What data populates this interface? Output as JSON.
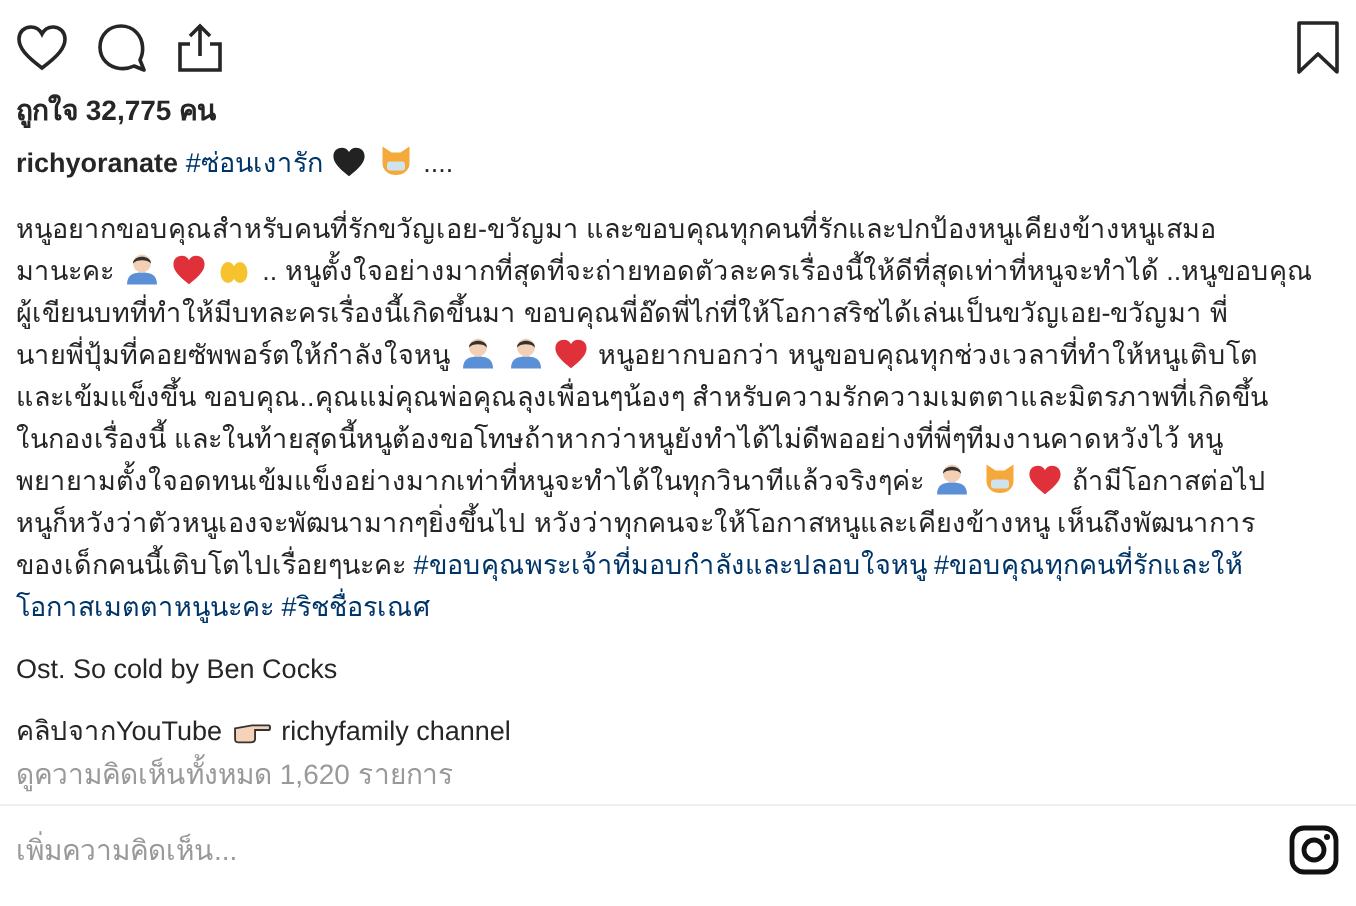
{
  "likes": "ถูกใจ 32,775 คน",
  "caption": {
    "username": "richyoranate",
    "heading": [
      {
        "kind": "tag",
        "text": "#ซ่อนเงารัก"
      },
      {
        "kind": "heart",
        "color": "#222222"
      },
      {
        "kind": "cat"
      },
      {
        "kind": "text",
        "text": "...."
      }
    ],
    "body_lines": [
      [
        {
          "kind": "text",
          "text": "หนูอยากขอบคุณสำหรับคนที่รักขวัญเอย-ขวัญมา และขอบคุณทุกคนที่รักและปกป้องหนูเคียงข้างหนูเสมอ"
        }
      ],
      [
        {
          "kind": "text",
          "text": "มานะคะ"
        },
        {
          "kind": "person"
        },
        {
          "kind": "heart",
          "color": "#e0303a"
        },
        {
          "kind": "hands"
        },
        {
          "kind": "text",
          "text": ".. หนูตั้งใจอย่างมากที่สุดที่จะถ่ายทอดตัวละครเรื่องนี้ให้ดีที่สุดเท่าที่หนูจะทำได้ ..หนูขอบคุณ"
        }
      ],
      [
        {
          "kind": "text",
          "text": "ผู้เขียนบทที่ทำให้มีบทละครเรื่องนี้เกิดขึ้นมา ขอบคุณพี่อ๊ดพี่ไก่ที่ให้โอกาสริชได้เล่นเป็นขวัญเอย-ขวัญมา พี่"
        }
      ],
      [
        {
          "kind": "text",
          "text": "นายพี่ปุ้มที่คอยซัพพอร์ตให้กำลังใจหนู"
        },
        {
          "kind": "person"
        },
        {
          "kind": "person"
        },
        {
          "kind": "heart",
          "color": "#e0303a"
        },
        {
          "kind": "text",
          "text": "หนูอยากบอกว่า หนูขอบคุณทุกช่วงเวลาที่ทำให้หนูเติบโต"
        }
      ],
      [
        {
          "kind": "text",
          "text": "และเข้มแข็งขึ้น ขอบคุณ..คุณแม่คุณพ่อคุณลุงเพื่อนๆน้องๆ สำหรับความรักความเมตตาและมิตรภาพที่เกิดขึ้น"
        }
      ],
      [
        {
          "kind": "text",
          "text": "ในกองเรื่องนี้ และในท้ายสุดนี้หนูต้องขอโทษถ้าหากว่าหนูยังทำได้ไม่ดีพออย่างที่พี่ๆทีมงานคาดหวังไว้ หนู"
        }
      ],
      [
        {
          "kind": "text",
          "text": "พยายามตั้งใจอดทนเข้มแข็งอย่างมากเท่าที่หนูจะทำได้ในทุกวินาทีแล้วจริงๆค่ะ"
        },
        {
          "kind": "person"
        },
        {
          "kind": "cat"
        },
        {
          "kind": "heart",
          "color": "#e0303a"
        },
        {
          "kind": "text",
          "text": "ถ้ามีโอกาสต่อไป"
        }
      ],
      [
        {
          "kind": "text",
          "text": "หนูก็หวังว่าตัวหนูเองจะพัฒนามากๆยิ่งขึ้นไป หวังว่าทุกคนจะให้โอกาสหนูและเคียงข้างหนู เห็นถึงพัฒนาการ"
        }
      ],
      [
        {
          "kind": "text",
          "text": "ของเด็กคนนี้เติบโตไปเรื่อยๆนะคะ"
        },
        {
          "kind": "tag",
          "text": "#ขอบคุณพระเจ้าที่มอบกำลังและปลอบใจหนู"
        },
        {
          "kind": "tag",
          "text": "#ขอบคุณทุกคนที่รักและให้"
        }
      ],
      [
        {
          "kind": "tag",
          "text": "โอกาสเมตตาหนูนะคะ"
        },
        {
          "kind": "tag",
          "text": "#ริชชื่อรเณศ"
        }
      ]
    ],
    "ost": "Ost. So cold by Ben Cocks",
    "source": [
      {
        "kind": "text",
        "text": "คลิปจากYouTube"
      },
      {
        "kind": "point"
      },
      {
        "kind": "text",
        "text": "richyfamily channel"
      }
    ]
  },
  "view_comments": "ดูความคิดเห็นทั้งหมด 1,620 รายการ",
  "comment_field": {
    "placeholder": "เพิ่มความคิดเห็น..."
  }
}
